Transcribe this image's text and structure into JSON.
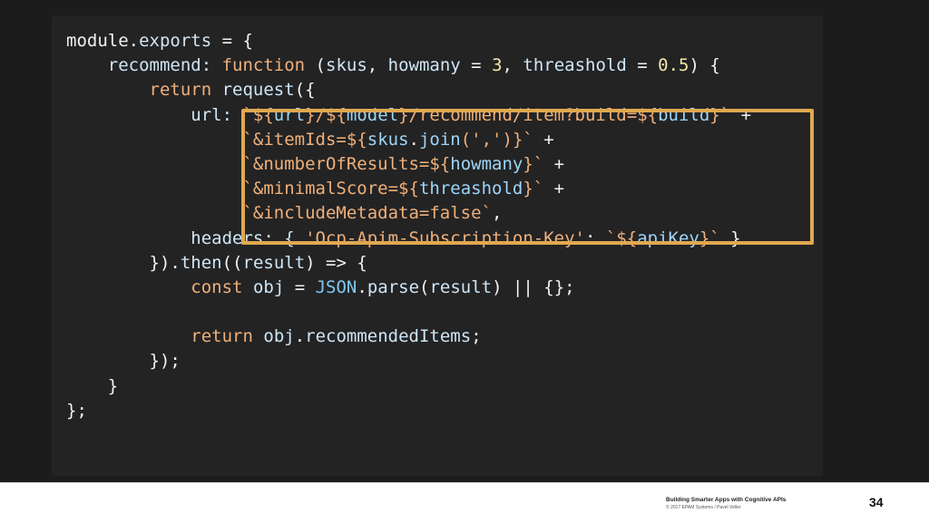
{
  "slide": {
    "page_number": "34",
    "footer_title": "Building Smarter Apps with Cognitive APIs",
    "footer_copyright": "© 2017 EPAM Systems / Pavel Veller"
  },
  "highlight_color": "#e0a850",
  "code": {
    "line1": {
      "a": "module",
      "b": ".",
      "c": "exports",
      "d": " = {"
    },
    "line2": {
      "a": "    recommend: ",
      "b": "function",
      "c": " (",
      "d": "skus",
      "e": ", ",
      "f": "howmany",
      "g": " = ",
      "h": "3",
      "i": ", ",
      "j": "threashold",
      "k": " = ",
      "l": "0.5",
      "m": ") {"
    },
    "line3": {
      "a": "        ",
      "b": "return",
      "c": " ",
      "d": "request",
      "e": "({"
    },
    "line4": {
      "a": "            url: ",
      "b": "`${",
      "c": "url",
      "d": "}/${",
      "e": "model",
      "f": "}/recommend/item?build=${",
      "g": "build",
      "h": "}`",
      "i": " +"
    },
    "line5": {
      "a": "                 ",
      "b": "`&itemIds=${",
      "c": "skus",
      "d": ".",
      "e": "join",
      "f": "(','",
      "g": ")}`",
      "h": " +"
    },
    "line6": {
      "a": "                 ",
      "b": "`&numberOfResults=${",
      "c": "howmany",
      "d": "}`",
      "e": " +"
    },
    "line7": {
      "a": "                 ",
      "b": "`&minimalScore=${",
      "c": "threashold",
      "d": "}`",
      "e": " +"
    },
    "line8": {
      "a": "                 ",
      "b": "`&includeMetadata=false`",
      "c": ","
    },
    "line9": {
      "a": "            headers: { ",
      "b": "'Ocp-Apim-Subscription-Key'",
      "c": ": ",
      "d": "`${",
      "e": "apiKey",
      "f": "}`",
      "g": " }"
    },
    "line10": {
      "a": "        }).",
      "b": "then",
      "c": "((",
      "d": "result",
      "e": ") => {"
    },
    "line11": {
      "a": "            ",
      "b": "const",
      "c": " ",
      "d": "obj",
      "e": " = ",
      "f": "JSON",
      "g": ".",
      "h": "parse",
      "i": "(",
      "j": "result",
      "k": ") || {};"
    },
    "line12": {
      "a": ""
    },
    "line13": {
      "a": "            ",
      "b": "return",
      "c": " ",
      "d": "obj",
      "e": ".",
      "f": "recommendedItems",
      "g": ";"
    },
    "line14": {
      "a": "        });"
    },
    "line15": {
      "a": "    }"
    },
    "line16": {
      "a": "};"
    }
  }
}
